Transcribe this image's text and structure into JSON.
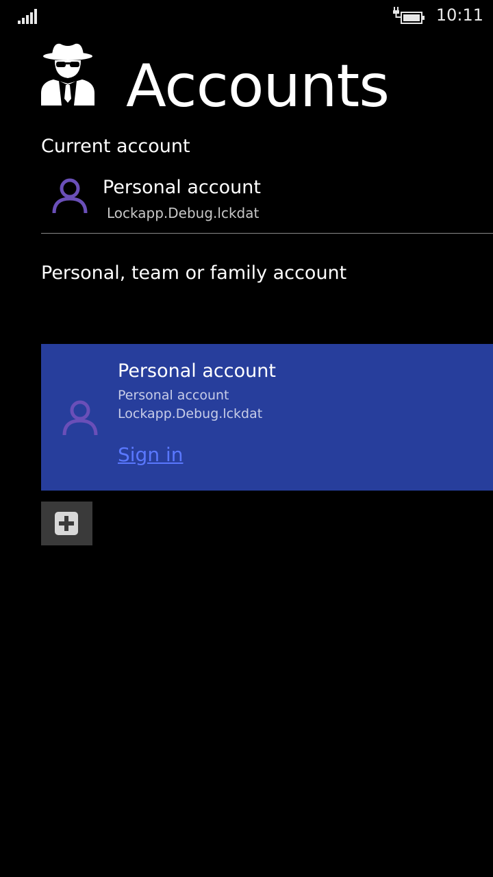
{
  "status_bar": {
    "time": "10:11",
    "signal_icon": "signal-bars-icon",
    "battery_icon": "battery-charging-icon"
  },
  "header": {
    "logo_icon": "spy-incognito-icon",
    "title": "Accounts"
  },
  "current_account": {
    "section_title": "Current account",
    "avatar_icon": "person-icon",
    "name": "Personal account",
    "file": "Lockapp.Debug.lckdat"
  },
  "accounts_list": {
    "section_title": "Personal, team or family account",
    "items": [
      {
        "avatar_icon": "person-icon",
        "name": "Personal account",
        "type": "Personal account",
        "file": "Lockapp.Debug.lckdat",
        "action_label": "Sign in"
      }
    ],
    "add_icon": "plus-icon"
  },
  "colors": {
    "background": "#000000",
    "card_background": "#273e9c",
    "link": "#5a78ff",
    "avatar": "#6a4fb8",
    "add_button": "#3a3a3a"
  }
}
